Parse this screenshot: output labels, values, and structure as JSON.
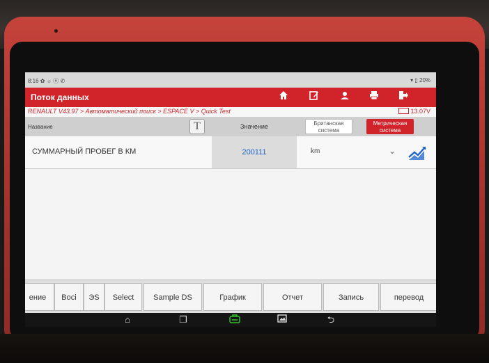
{
  "statusbar": {
    "time": "8:16 ✿ ☼ ⓔ ✆",
    "right": "▾ ▯ 20%"
  },
  "appbar": {
    "title": "Поток данных",
    "icons": [
      "home-icon",
      "edit-report-icon",
      "user-icon",
      "print-icon",
      "exit-icon"
    ]
  },
  "breadcrumb": "RENAULT V43.97 > Автоматический поиск > ESPACE V > Quick Test",
  "voltage": "13.07V",
  "table": {
    "headers": {
      "name": "Название",
      "text_toggle": "T",
      "value": "Значение",
      "british": "Британская система",
      "metric": "Метрическая система"
    },
    "rows": [
      {
        "name": "СУММАРНЫЙ ПРОБЕГ В КМ",
        "value": "200111",
        "unit": "km"
      }
    ]
  },
  "toolbar": {
    "buttons": [
      "ение",
      "Восі",
      "ЭS",
      "Select",
      "Sample DS",
      "График",
      "Отчет",
      "Запись",
      "перевод"
    ]
  },
  "navbar": {
    "icons": [
      "home-icon",
      "recent-apps-icon",
      "diagnostic-download-icon",
      "screenshot-icon",
      "back-icon"
    ]
  }
}
